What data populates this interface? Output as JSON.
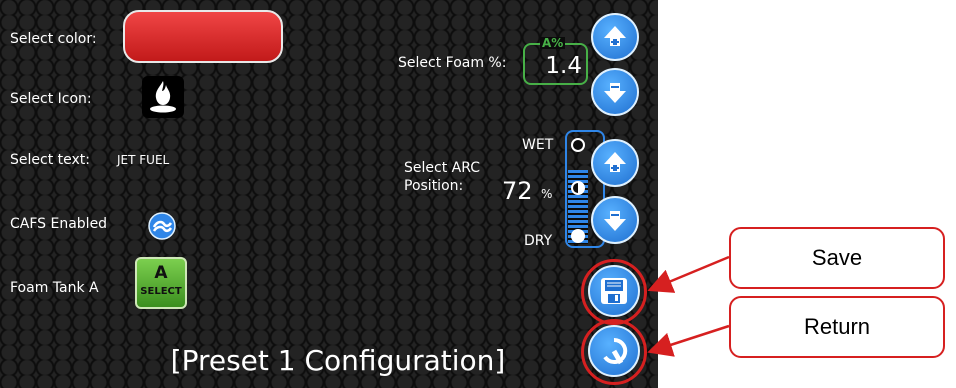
{
  "preset": {
    "color_label": "Select color:",
    "selected_color": "#d92626",
    "icon_label": "Select Icon:",
    "selected_icon": "fire-icon",
    "text_label": "Select text:",
    "text_value": "JET FUEL",
    "cafs_label": "CAFS Enabled",
    "cafs_icon": "cafs-wave-icon",
    "tank_label": "Foam Tank A",
    "tank_button_glyph": "A",
    "tank_button_text": "SELECT"
  },
  "foam": {
    "label": "Select Foam %:",
    "tag": "A%",
    "value": "1.4",
    "accent": "#47b047"
  },
  "arc": {
    "label_line1": "Select ARC",
    "label_line2": "Position:",
    "value": "72",
    "unit": "%",
    "wet_label": "WET",
    "dry_label": "DRY",
    "accent": "#2f86e8"
  },
  "title": "[Preset 1 Configuration]",
  "callouts": {
    "save": "Save",
    "return": "Return",
    "color": "#d62020"
  }
}
